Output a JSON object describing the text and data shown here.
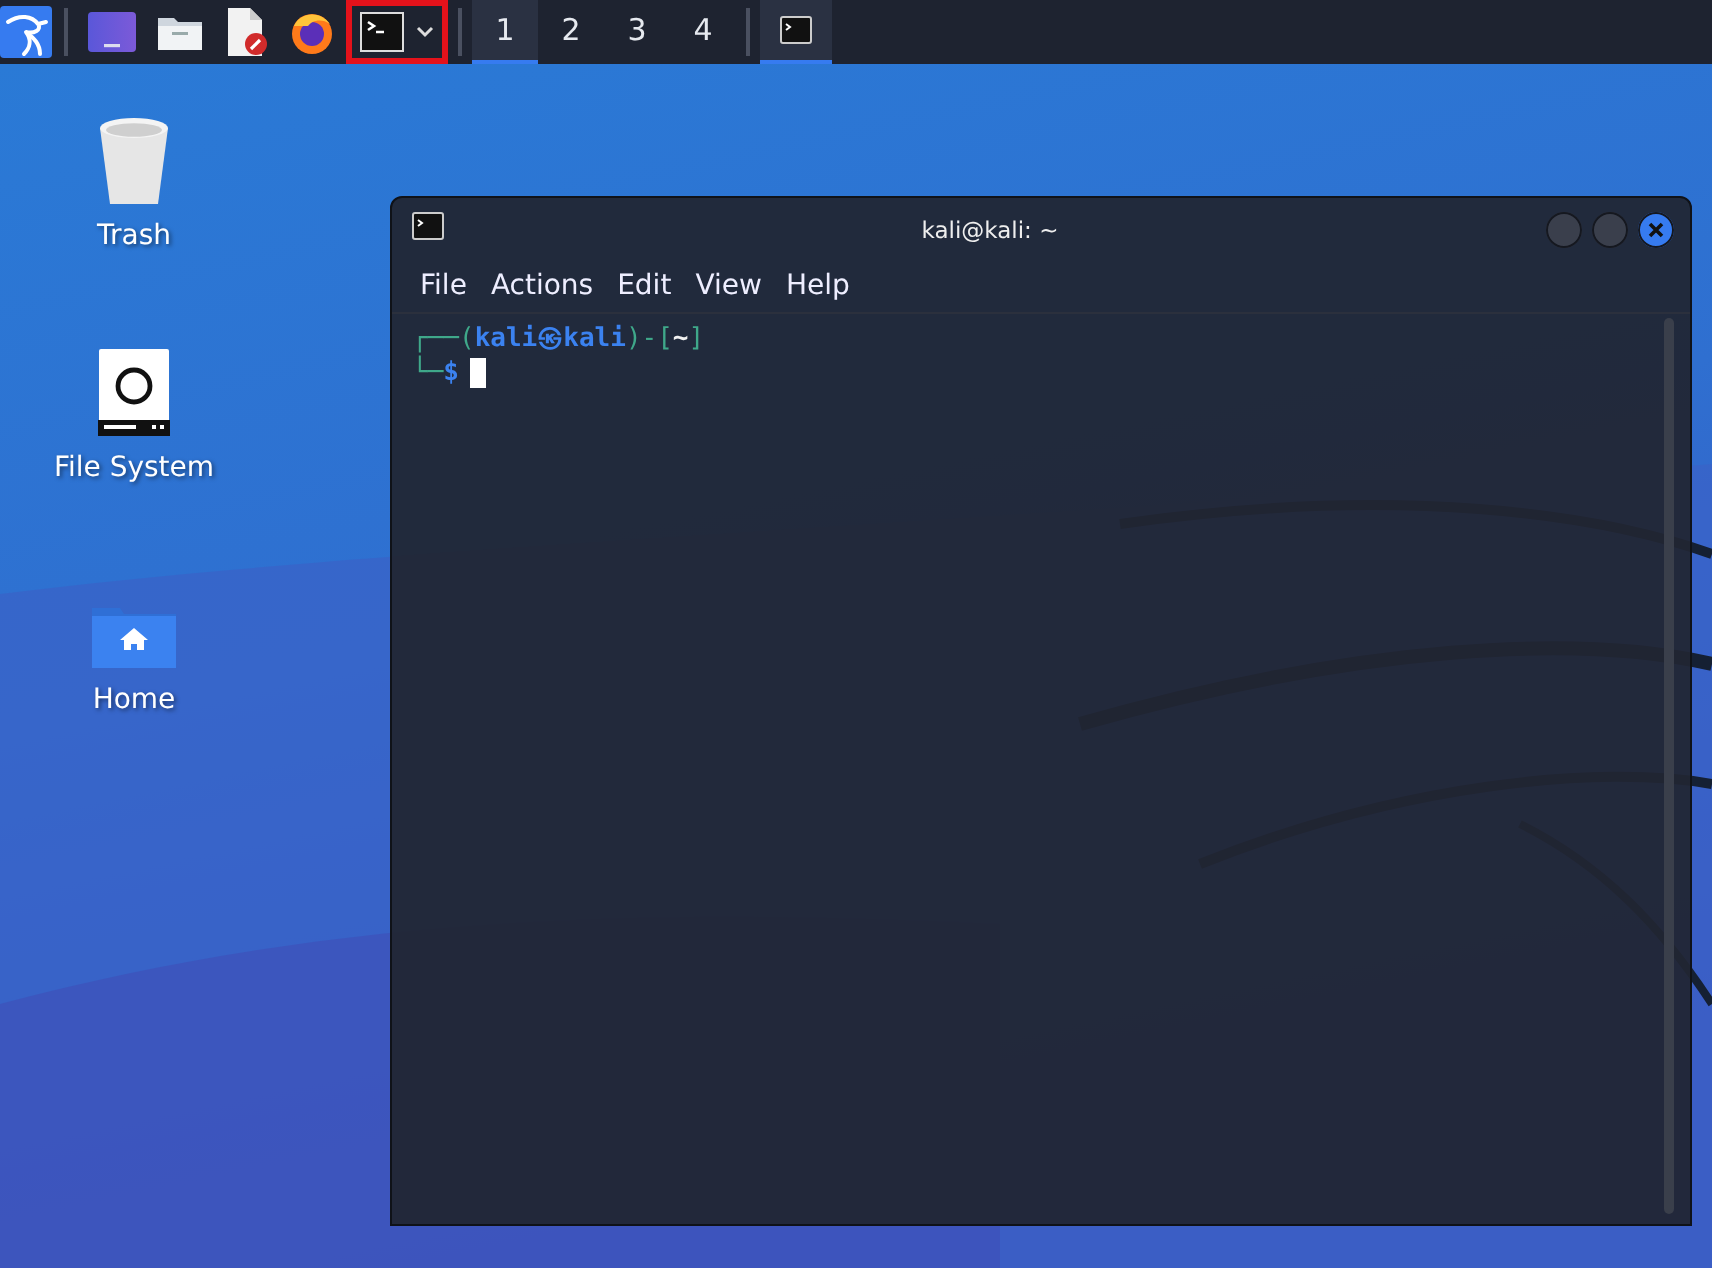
{
  "taskbar": {
    "launchers": [
      {
        "kind": "menu"
      },
      {
        "kind": "desktop"
      },
      {
        "kind": "files"
      },
      {
        "kind": "editor"
      },
      {
        "kind": "browser"
      },
      {
        "kind": "terminal",
        "highlighted": true
      }
    ],
    "workspaces": [
      {
        "label": "1",
        "selected": true
      },
      {
        "label": "2",
        "selected": false
      },
      {
        "label": "3",
        "selected": false
      },
      {
        "label": "4",
        "selected": false
      }
    ],
    "tasks": [
      {
        "kind": "terminal",
        "selected": true
      }
    ]
  },
  "desktop_icons": [
    {
      "label": "Trash",
      "kind": "trash"
    },
    {
      "label": "File System",
      "kind": "drive"
    },
    {
      "label": "Home",
      "kind": "home"
    }
  ],
  "window": {
    "title": "kali@kali: ~",
    "controls": [
      {
        "kind": "minimize"
      },
      {
        "kind": "maximize"
      },
      {
        "kind": "close"
      }
    ],
    "menu": [
      "File",
      "Actions",
      "Edit",
      "View",
      "Help"
    ],
    "lines": [
      [
        {
          "text": "┌──(",
          "kind": "frame"
        },
        {
          "text": "kali㉿kali",
          "kind": "user"
        },
        {
          "text": ")-[",
          "kind": "frame"
        },
        {
          "text": "~",
          "kind": "path"
        },
        {
          "text": "]",
          "kind": "frame"
        }
      ],
      [
        {
          "text": "└─",
          "kind": "frame"
        },
        {
          "text": "$",
          "kind": "user"
        }
      ]
    ],
    "cursor": true
  }
}
